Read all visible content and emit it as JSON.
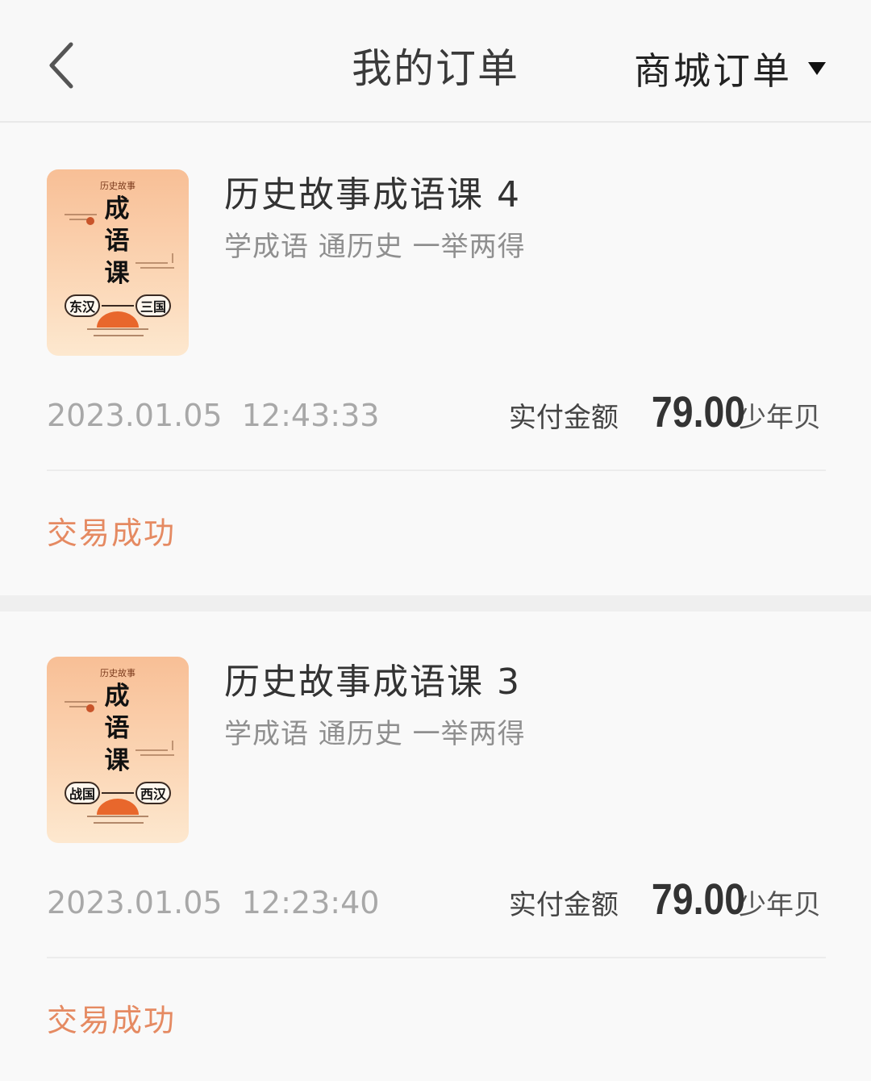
{
  "header": {
    "title": "我的订单",
    "order_type": "商城订单",
    "back_icon": "chevron-left-icon",
    "caret_icon": "caret-down-icon"
  },
  "orders": [
    {
      "cover": {
        "series": "历史故事",
        "chars": [
          "成",
          "语",
          "课"
        ],
        "period_start": "东汉",
        "period_end": "三国"
      },
      "title": "历史故事成语课 4",
      "subtitle": "学成语 通历史 一举两得",
      "date": "2023.01.05",
      "time": "12:43:33",
      "amount_label": "实付金额",
      "amount": "79.00",
      "currency": "少年贝",
      "status": "交易成功"
    },
    {
      "cover": {
        "series": "历史故事",
        "chars": [
          "成",
          "语",
          "课"
        ],
        "period_start": "战国",
        "period_end": "西汉"
      },
      "title": "历史故事成语课 3",
      "subtitle": "学成语 通历史 一举两得",
      "date": "2023.01.05",
      "time": "12:23:40",
      "amount_label": "实付金额",
      "amount": "79.00",
      "currency": "少年贝",
      "status": "交易成功"
    }
  ],
  "colors": {
    "status": "#e58a62",
    "background": "#f8f8f8",
    "cover_gradient_top": "#f8bf96",
    "cover_gradient_bottom": "#fde8cf"
  }
}
